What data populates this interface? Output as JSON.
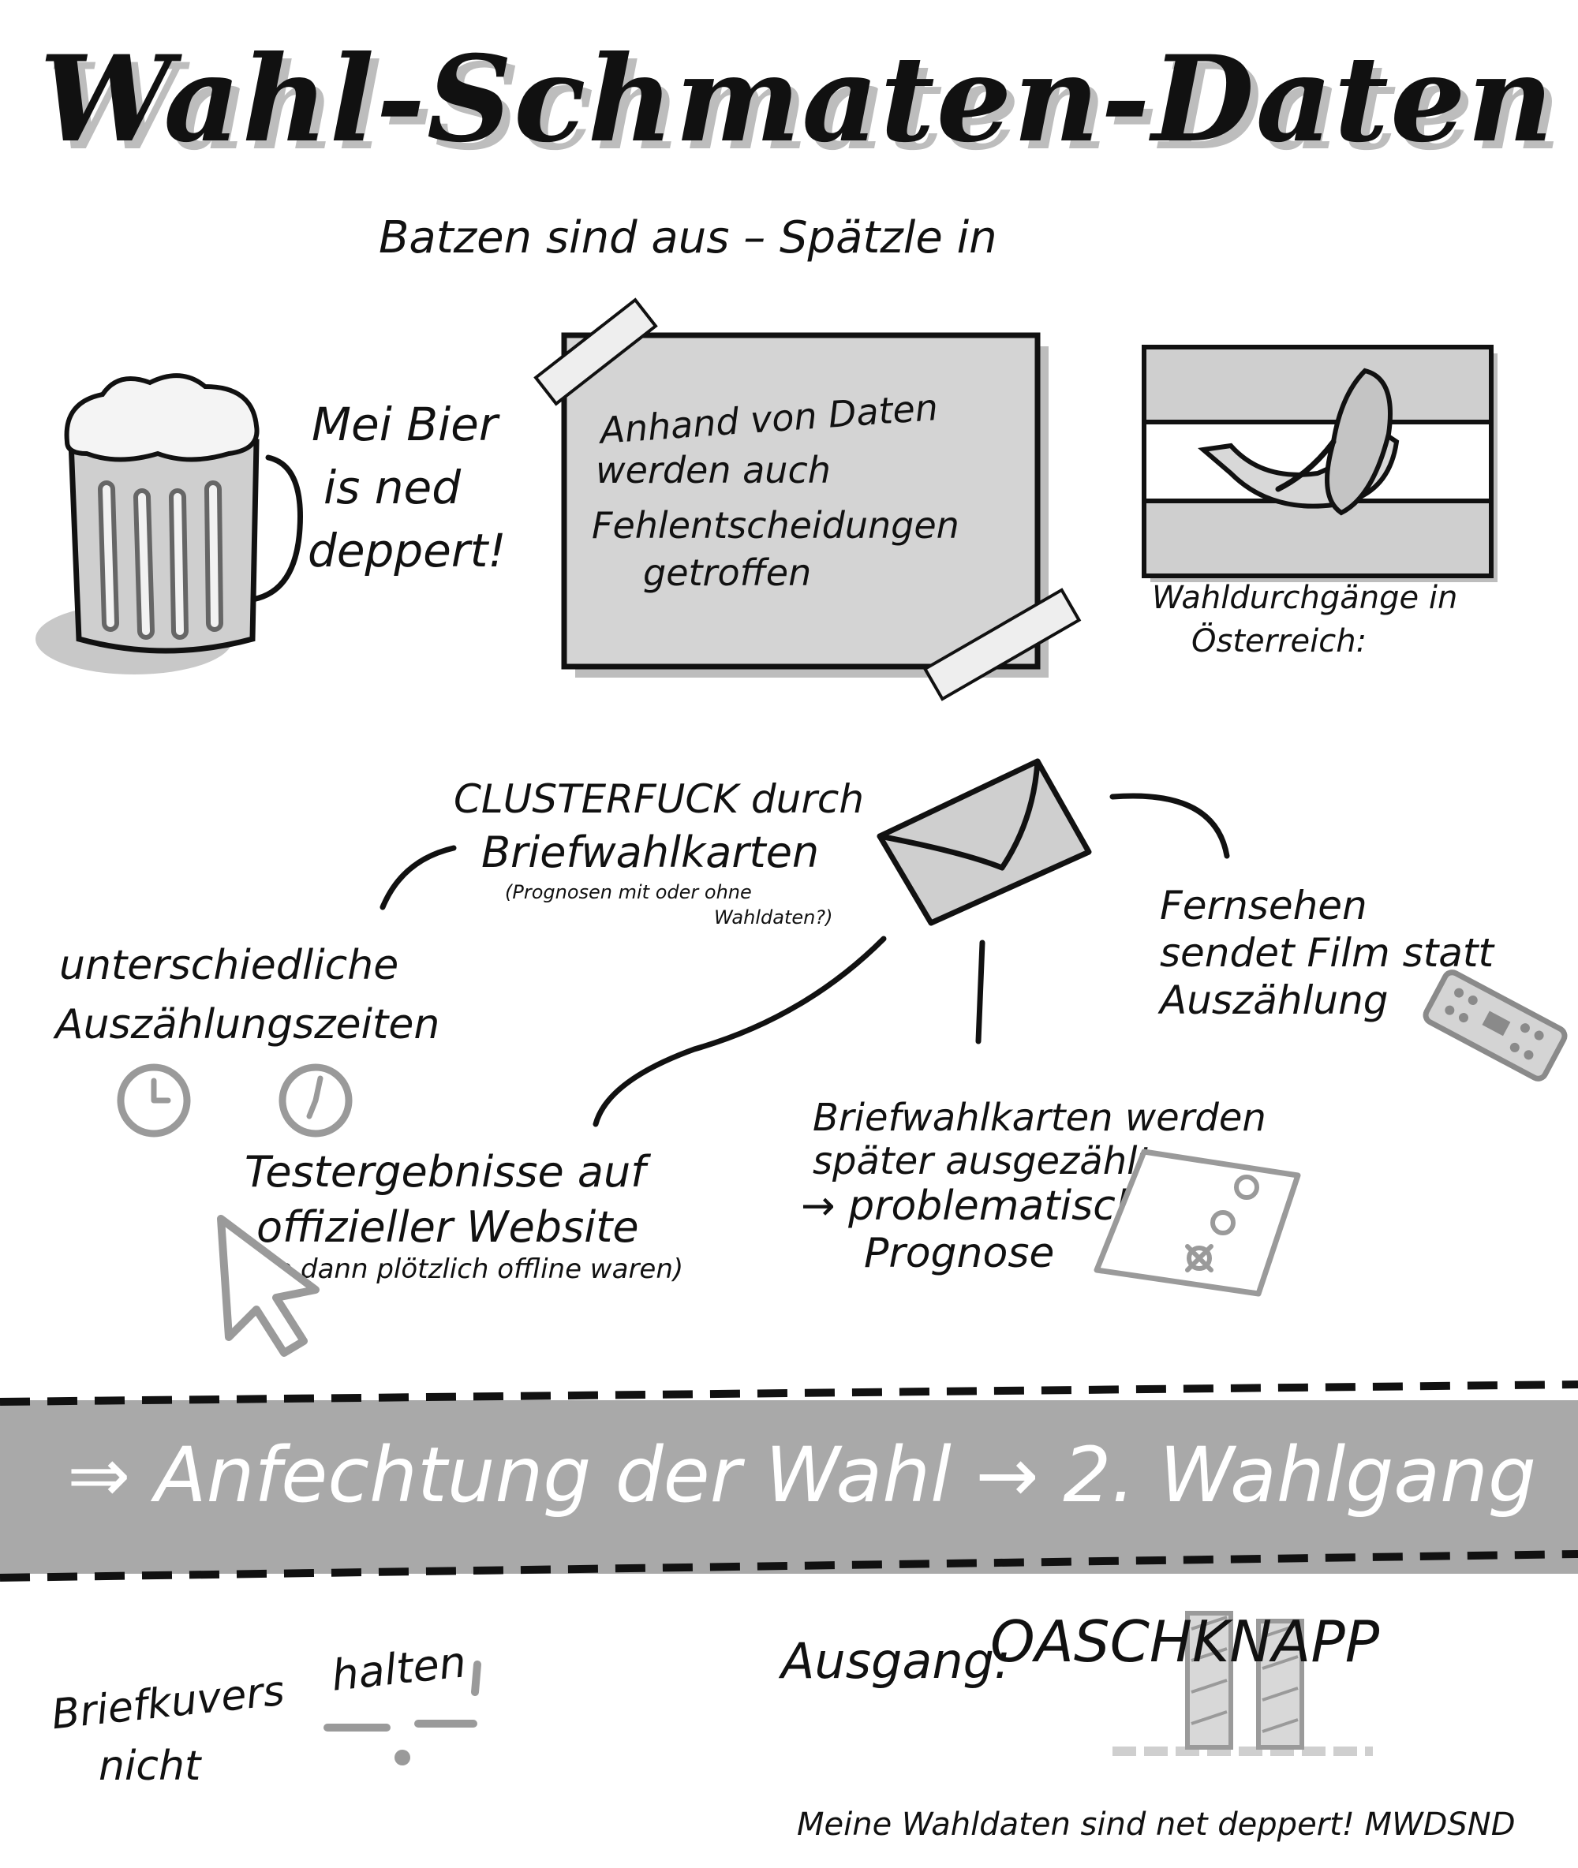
{
  "title": "Wahl-Schmaten-Daten",
  "subtitle": "Batzen sind aus – Spätzle in",
  "beer": {
    "line1": "Mei Bier",
    "line2": "is ned",
    "line3": "deppert!"
  },
  "note": {
    "line1": "Anhand von Daten",
    "line2": "werden auch",
    "line3": "Fehlentscheidungen",
    "line4": "getroffen"
  },
  "flag_caption": {
    "line1": "Wahldurchgänge in",
    "line2": "Österreich:"
  },
  "cluster": {
    "line1": "CLUSTERFUCK durch",
    "line2": "Briefwahlkarten",
    "aside1": "(Prognosen mit oder ohne",
    "aside2": "Wahldaten?)"
  },
  "tv": {
    "line1": "Fernsehen",
    "line2": "sendet Film statt",
    "line3": "Auszählung"
  },
  "times": {
    "line1": "unterschiedliche",
    "line2": "Auszählungszeiten"
  },
  "test": {
    "line1": "Testergebnisse auf",
    "line2": "offizieller Website",
    "line3": "(die dann plötzlich offline waren)"
  },
  "later": {
    "line1": "Briefwahlkarten werden",
    "line2": "später ausgezählt",
    "line3": "→ problematisch für",
    "line4": "Prognose"
  },
  "band": {
    "text": "⇒ Anfechtung der Wahl → 2. Wahlgang"
  },
  "kuvert": {
    "line1": "Briefkuvers",
    "line2": "halten",
    "line3": "nicht"
  },
  "ausgang": {
    "label": "Ausgang:",
    "value": "OASCHKNAPP"
  },
  "footer": {
    "text": "Meine Wahldaten sind net deppert! MWDSND"
  },
  "colors": {
    "ink": "#111111",
    "grey_fill": "#d0d0d0",
    "band": "#a9a9a9",
    "shadow": "#bdbdbd"
  },
  "icons": [
    "beer-mug-icon",
    "sticky-note-icon",
    "austria-flag-banana-icon",
    "envelope-icon",
    "tv-remote-icon",
    "clock-icon",
    "cursor-arrow-icon",
    "ballot-sheet-icon",
    "bar-chart-icon"
  ]
}
